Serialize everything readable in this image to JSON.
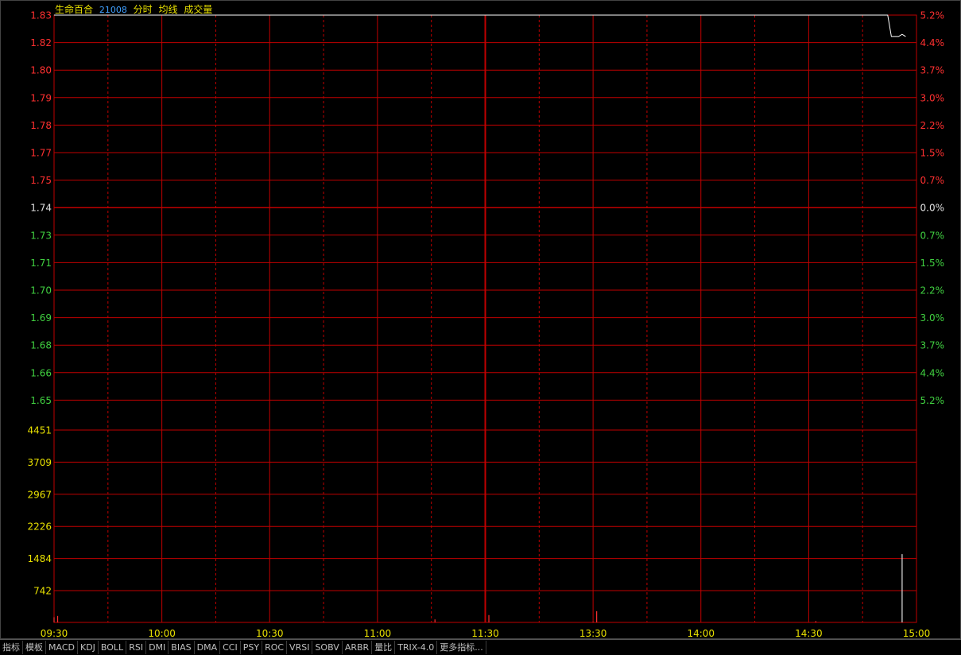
{
  "header": {
    "stock_name": "生命百合",
    "stock_code": "21008",
    "mode_label": "分时",
    "avg_label": "均线",
    "vol_label": "成交量"
  },
  "colors": {
    "grid": "#c00000",
    "up": "#ff3030",
    "down": "#40d040",
    "neutral": "#e0e0e0",
    "volume_axis": "#e8e000",
    "time_axis": "#e8e000",
    "price_line": "#ffffff"
  },
  "chart_data": {
    "type": "line",
    "price_axis": {
      "left_labels": [
        "1.83",
        "1.82",
        "1.80",
        "1.79",
        "1.78",
        "1.77",
        "1.75",
        "1.74",
        "1.73",
        "1.71",
        "1.70",
        "1.69",
        "1.68",
        "1.66",
        "1.65"
      ],
      "right_labels": [
        "5.2%",
        "4.4%",
        "3.7%",
        "3.0%",
        "2.2%",
        "1.5%",
        "0.7%",
        "0.0%",
        "0.7%",
        "1.5%",
        "2.2%",
        "3.0%",
        "3.7%",
        "4.4%",
        "5.2%"
      ],
      "prev_close": 1.74,
      "ylim": [
        1.65,
        1.83
      ]
    },
    "volume_axis": {
      "labels": [
        "4451",
        "3709",
        "2967",
        "2226",
        "1484",
        "742"
      ],
      "ylim": [
        0,
        4451
      ]
    },
    "time_axis": {
      "labels": [
        "09:30",
        "10:00",
        "10:30",
        "11:00",
        "11:30",
        "13:30",
        "14:00",
        "14:30",
        "15:00"
      ]
    },
    "price_series": [
      {
        "t": 0,
        "v": 1.83
      },
      {
        "t": 232,
        "v": 1.83
      },
      {
        "t": 233,
        "v": 1.82
      },
      {
        "t": 235,
        "v": 1.82
      },
      {
        "t": 236,
        "v": 1.821
      },
      {
        "t": 237,
        "v": 1.82
      }
    ],
    "volume_bars": [
      {
        "t": 0,
        "v": 120,
        "c": "up"
      },
      {
        "t": 1,
        "v": 150,
        "c": "up"
      },
      {
        "t": 106,
        "v": 70,
        "c": "up"
      },
      {
        "t": 121,
        "v": 170,
        "c": "up"
      },
      {
        "t": 150,
        "v": 15,
        "c": "up"
      },
      {
        "t": 151,
        "v": 260,
        "c": "up"
      },
      {
        "t": 212,
        "v": 30,
        "c": "up"
      },
      {
        "t": 236,
        "v": 1580,
        "c": "neutral"
      }
    ]
  },
  "toolbar": {
    "tabs": [
      "指标",
      "模板",
      "MACD",
      "KDJ",
      "BOLL",
      "RSI",
      "DMI",
      "BIAS",
      "DMA",
      "CCI",
      "PSY",
      "ROC",
      "VRSI",
      "SOBV",
      "ARBR",
      "量比",
      "TRIX-4.0",
      "更多指标..."
    ]
  }
}
